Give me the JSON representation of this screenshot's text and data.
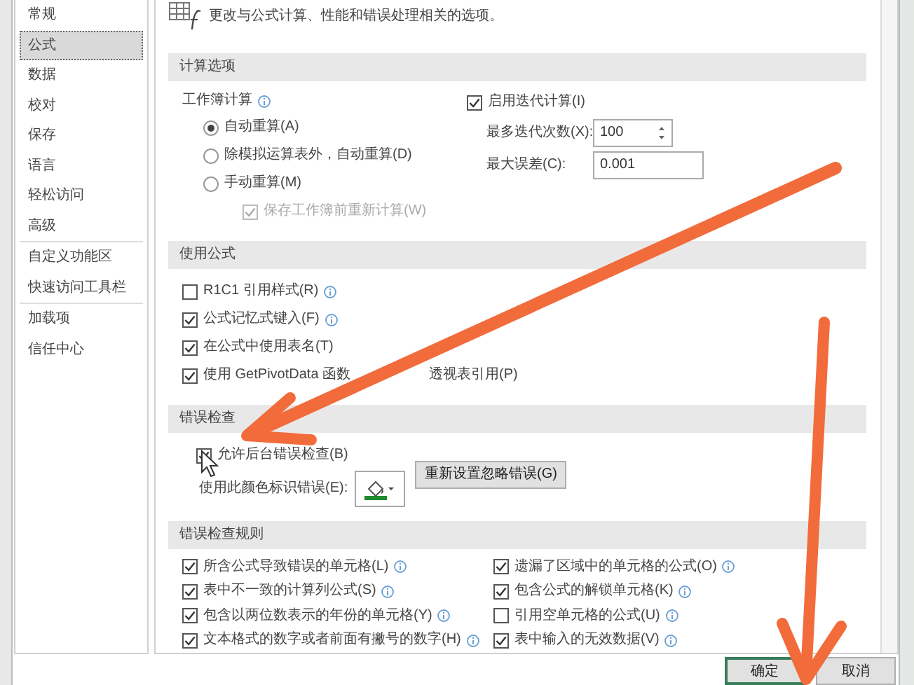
{
  "sidebar": {
    "items": [
      {
        "label": "常规",
        "selected": false,
        "divider_after": false
      },
      {
        "label": "公式",
        "selected": true,
        "divider_after": false
      },
      {
        "label": "数据",
        "selected": false,
        "divider_after": false
      },
      {
        "label": "校对",
        "selected": false,
        "divider_after": false
      },
      {
        "label": "保存",
        "selected": false,
        "divider_after": false
      },
      {
        "label": "语言",
        "selected": false,
        "divider_after": false
      },
      {
        "label": "轻松访问",
        "selected": false,
        "divider_after": false
      },
      {
        "label": "高级",
        "selected": false,
        "divider_after": true
      },
      {
        "label": "自定义功能区",
        "selected": false,
        "divider_after": false
      },
      {
        "label": "快速访问工具栏",
        "selected": false,
        "divider_after": true
      },
      {
        "label": "加载项",
        "selected": false,
        "divider_after": false
      },
      {
        "label": "信任中心",
        "selected": false,
        "divider_after": false
      }
    ]
  },
  "header": {
    "text": "更改与公式计算、性能和错误处理相关的选项。"
  },
  "calculation": {
    "title": "计算选项",
    "workbook_label": "工作簿计算",
    "modes": [
      {
        "label": "自动重算(A)",
        "selected": true
      },
      {
        "label": "除模拟运算表外，自动重算(D)",
        "selected": false
      },
      {
        "label": "手动重算(M)",
        "selected": false
      }
    ],
    "save_before": {
      "label": "保存工作簿前重新计算(W)",
      "checked": true,
      "disabled": true
    },
    "iterative": {
      "label": "启用迭代计算(I)",
      "checked": true
    },
    "max_iterations": {
      "label": "最多迭代次数(X):",
      "value": "100"
    },
    "max_change": {
      "label": "最大误差(C):",
      "value": "0.001"
    }
  },
  "formulas": {
    "title": "使用公式",
    "options": [
      {
        "label": "R1C1 引用样式(R)",
        "checked": false,
        "info": true
      },
      {
        "label": "公式记忆式键入(F)",
        "checked": true,
        "info": true
      },
      {
        "label": "在公式中使用表名(T)",
        "checked": true,
        "info": false
      },
      {
        "label": "使用 GetPivotData 函数",
        "label_after_arrow": "透视表引用(P)",
        "checked": true,
        "info": false
      }
    ]
  },
  "error_checking": {
    "title": "错误检查",
    "enable": {
      "label": "允许后台错误检查(B)",
      "checked": true
    },
    "color_label": "使用此颜色标识错误(E):",
    "reset_button": "重新设置忽略错误(G)"
  },
  "error_rules": {
    "title": "错误检查规则",
    "left": [
      {
        "label": "所含公式导致错误的单元格(L)",
        "checked": true,
        "info": true
      },
      {
        "label": "表中不一致的计算列公式(S)",
        "checked": true,
        "info": true
      },
      {
        "label": "包含以两位数表示的年份的单元格(Y)",
        "checked": true,
        "info": true
      },
      {
        "label": "文本格式的数字或者前面有撇号的数字(H)",
        "checked": true,
        "info": true
      }
    ],
    "right": [
      {
        "label": "遗漏了区域中的单元格的公式(O)",
        "checked": true,
        "info": true
      },
      {
        "label": "包含公式的解锁单元格(K)",
        "checked": true,
        "info": true
      },
      {
        "label": "引用空单元格的公式(U)",
        "checked": false,
        "info": true
      },
      {
        "label": "表中输入的无效数据(V)",
        "checked": true,
        "info": true
      }
    ]
  },
  "buttons": [
    {
      "label": "确定",
      "default": true
    },
    {
      "label": "取消",
      "default": false
    }
  ]
}
